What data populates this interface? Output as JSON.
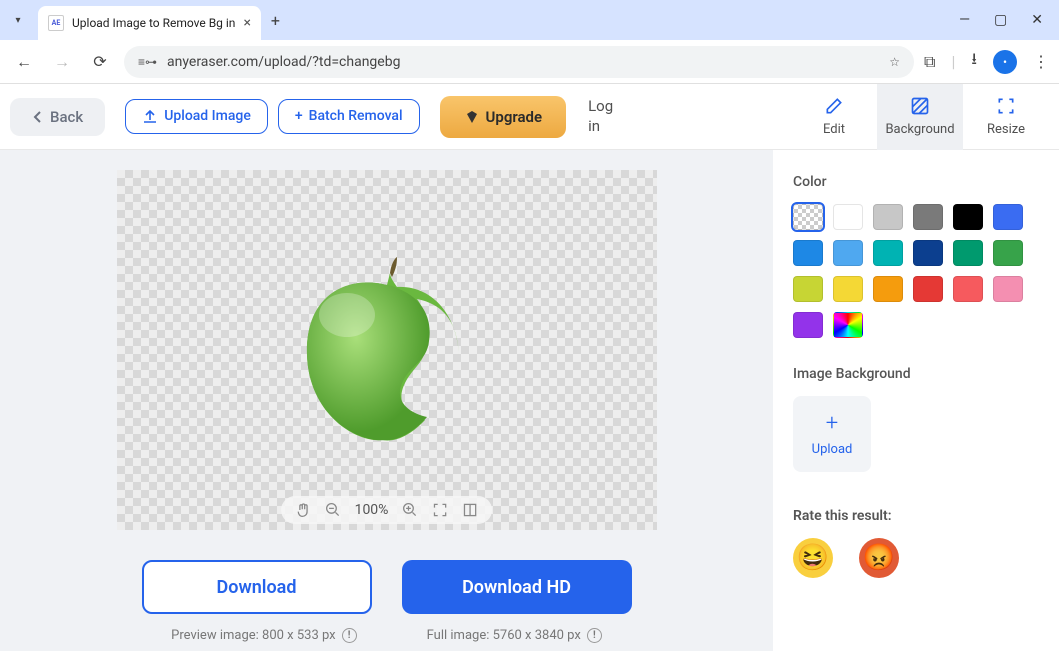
{
  "browser": {
    "tab_title": "Upload Image to Remove Bg in",
    "favicon_text": "AE",
    "url": "anyeraser.com/upload/?td=changebg"
  },
  "toolbar": {
    "back_label": "Back",
    "upload_label": "Upload Image",
    "batch_label": "Batch Removal",
    "upgrade_label": "Upgrade",
    "login_label": "Log in",
    "edit_label": "Edit",
    "background_label": "Background",
    "resize_label": "Resize"
  },
  "canvas": {
    "zoom_level": "100%",
    "download_label": "Download",
    "download_hd_label": "Download HD",
    "preview_meta": "Preview image: 800 x 533 px",
    "full_meta": "Full image: 5760 x 3840 px"
  },
  "panel": {
    "color_label": "Color",
    "image_bg_label": "Image Background",
    "upload_label": "Upload",
    "rate_label": "Rate this result:",
    "colors": [
      "transparent",
      "#ffffff",
      "#c7c7c7",
      "#7a7a7a",
      "#000000",
      "#3a6cf2",
      "#1e88e5",
      "#4fa8f0",
      "#00b3b3",
      "#0c3f8f",
      "#009a6e",
      "#37a34a",
      "#c7d534",
      "#f4d835",
      "#f59c0d",
      "#e53935",
      "#f65a5e",
      "#f48fb1",
      "#9333ea",
      "rainbow"
    ]
  }
}
